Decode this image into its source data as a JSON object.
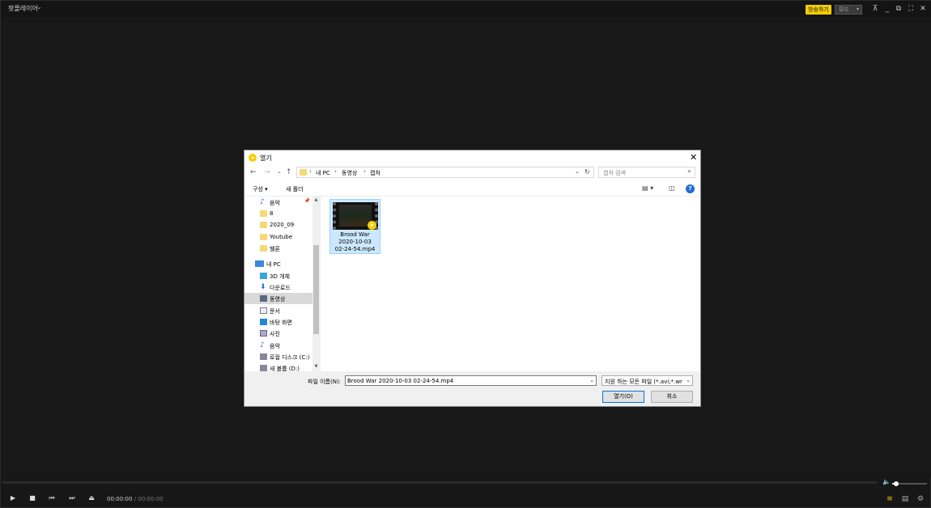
{
  "app": {
    "title": "팟플레이어",
    "title_chevron": "⌄",
    "broadcast_label": "방송하기",
    "mode_label": "모드",
    "colors": {
      "accent": "#f5cf00",
      "background": "#171717"
    }
  },
  "window_controls": {
    "pin": "⊼",
    "minimize": "_",
    "restore": "⧉",
    "fullscreen": "⛶",
    "close": "✕"
  },
  "dialog": {
    "title": "열기",
    "close": "✕",
    "nav": {
      "back": "←",
      "forward": "→",
      "recent": "⌄",
      "up": "↑"
    },
    "breadcrumb": [
      "내 PC",
      "동영상",
      "캡처"
    ],
    "breadcrumb_sep": "›",
    "address_dropdown": "⌄",
    "refresh": "↻",
    "search_placeholder": "캡처 검색",
    "search_icon": "⌕",
    "toolbar": {
      "organize": "구성 ▾",
      "new_folder": "새 폴더",
      "view_icon": "▤ ▾",
      "preview_icon": "◫",
      "help": "?"
    },
    "nav_items": [
      {
        "label": "음악",
        "icon": "music",
        "pinned": true
      },
      {
        "label": "8",
        "icon": "folder"
      },
      {
        "label": "2020_09",
        "icon": "folder"
      },
      {
        "label": "Youtube",
        "icon": "folder"
      },
      {
        "label": "웰론",
        "icon": "folder"
      },
      {
        "label": "내 PC",
        "icon": "pc"
      },
      {
        "label": "3D 개체",
        "icon": "3d"
      },
      {
        "label": "다운로드",
        "icon": "download"
      },
      {
        "label": "동영상",
        "icon": "video",
        "selected": true
      },
      {
        "label": "문서",
        "icon": "document"
      },
      {
        "label": "바탕 화면",
        "icon": "desktop"
      },
      {
        "label": "사진",
        "icon": "pictures"
      },
      {
        "label": "음악",
        "icon": "music"
      },
      {
        "label": "로컬 디스크 (C:)",
        "icon": "disk"
      },
      {
        "label": "새 볼륨 (D:)",
        "icon": "disk"
      }
    ],
    "pin_glyph": "📌",
    "files": [
      {
        "name": "Brood War 2020-10-03 02-24-54.mp4",
        "name_lines": [
          "Brood War",
          "2020-10-03",
          "02-24-54.mp4"
        ],
        "selected": true
      }
    ],
    "filename_label": "파일 이름(N):",
    "filename_value": "Brood War 2020-10-03 02-24-54.mp4",
    "filetype_value": "지원 하는 모든 파일 (*.avi;*.wr",
    "dropdown_glyph": "⌄",
    "open_button": "열기(O)",
    "cancel_button": "취소"
  },
  "player": {
    "play": "▶",
    "stop": "■",
    "prev": "⏮",
    "next": "⏭",
    "eject": "⏏",
    "time_current": "00:00:00",
    "time_sep": "/",
    "time_total": "00:00:00",
    "volume_icon": "🔈",
    "volume_level": 0.12,
    "playlist_icon": "≡",
    "menu_icon": "▤",
    "settings_icon": "⚙"
  }
}
